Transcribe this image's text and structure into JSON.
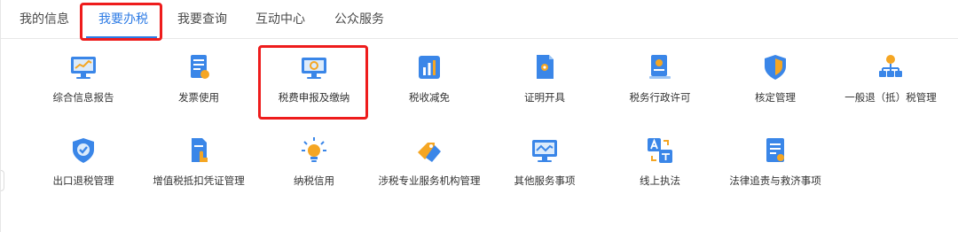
{
  "tabs": [
    {
      "label": "我的信息"
    },
    {
      "label": "我要办税"
    },
    {
      "label": "我要查询"
    },
    {
      "label": "互动中心"
    },
    {
      "label": "公众服务"
    }
  ],
  "active_tab": "我要办税",
  "colors": {
    "accent": "#2d7be5",
    "highlight": "#ee1c1c",
    "icon_blue": "#3a86e8",
    "icon_orange": "#f5a623"
  },
  "services_row1": [
    {
      "label": "综合信息报告",
      "icon": "monitor-chart-icon"
    },
    {
      "label": "发票使用",
      "icon": "invoice-document-icon"
    },
    {
      "label": "税费申报及缴纳",
      "icon": "monitor-declare-icon"
    },
    {
      "label": "税收减免",
      "icon": "bar-chart-icon"
    },
    {
      "label": "证明开具",
      "icon": "certificate-doc-icon"
    },
    {
      "label": "税务行政许可",
      "icon": "license-badge-icon"
    },
    {
      "label": "核定管理",
      "icon": "shield-icon"
    },
    {
      "label": "一般退（抵）税管理",
      "icon": "org-tree-icon"
    }
  ],
  "services_row2": [
    {
      "label": "出口退税管理",
      "icon": "shield-check-icon"
    },
    {
      "label": "增值税抵扣凭证管理",
      "icon": "doc-hand-icon"
    },
    {
      "label": "纳税信用",
      "icon": "lightbulb-icon"
    },
    {
      "label": "涉税专业服务机构管理",
      "icon": "tags-icon"
    },
    {
      "label": "其他服务事项",
      "icon": "monitor-wave-icon"
    },
    {
      "label": "线上执法",
      "icon": "translate-icon"
    },
    {
      "label": "法律追责与救济事项",
      "icon": "legal-doc-icon"
    }
  ]
}
